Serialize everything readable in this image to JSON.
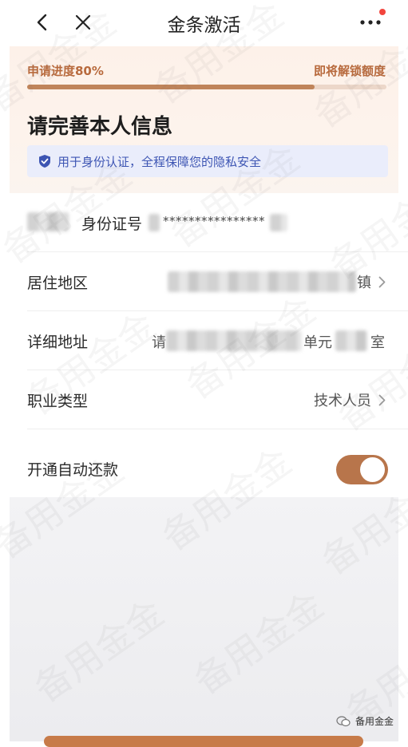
{
  "nav": {
    "title": "金条激活"
  },
  "progress": {
    "label": "申请进度80%",
    "unlock_label": "即将解锁额度",
    "fraction": 0.8
  },
  "header": {
    "title": "请完善本人信息",
    "privacy_text": "用于身份认证，全程保障您的隐私安全"
  },
  "form": {
    "id_label": "身份证号",
    "id_value": "****************",
    "residence_label": "居住地区",
    "residence_value_visible": "镇",
    "address_label": "详细地址",
    "address_prefix_visible": "请",
    "address_suffix_visible": "单元",
    "address_tail_visible": "室",
    "occupation_label": "职业类型",
    "occupation_value": "技术人员",
    "autopay_label": "开通自动还款",
    "autopay_enabled": true
  },
  "footer": {
    "account_name": "备用金金"
  },
  "watermark": {
    "text": "备用金金"
  },
  "colors": {
    "accent": "#b8754b",
    "progress_fill": "#c0845a",
    "privacy_blue": "#3d55b3",
    "badge_red": "#f2453d"
  }
}
